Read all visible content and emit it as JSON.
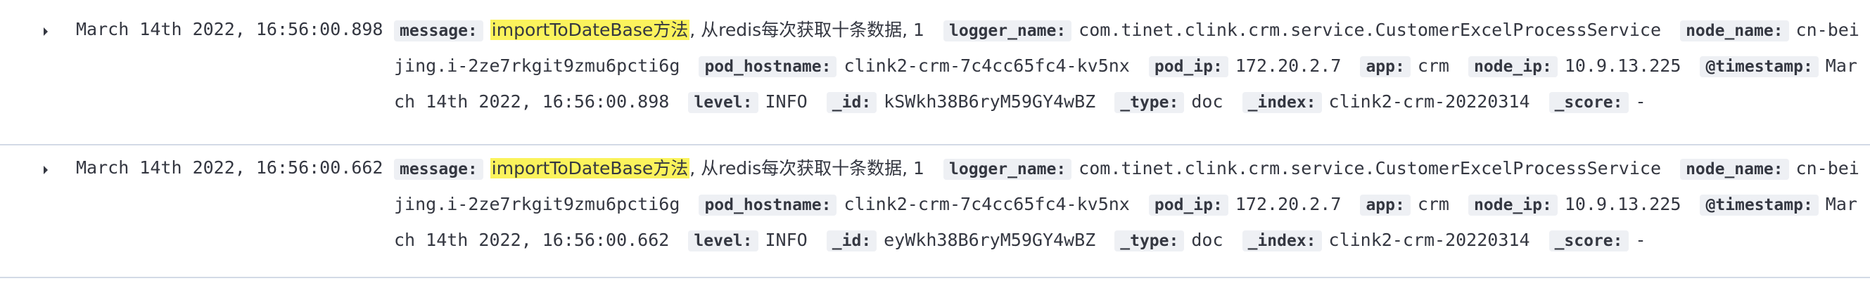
{
  "rows": [
    {
      "time": "March 14th 2022, 16:56:00.898",
      "message_highlight": "importToDateBase方法",
      "message_rest": ", 从redis每次获取十条数据, 1",
      "fields": [
        {
          "key": "logger_name:",
          "value": "com.tinet.clink.crm.service.CustomerExcelProcessService"
        },
        {
          "key": "node_name:",
          "value": "cn-beijing.i-2ze7rkgit9zmu6pcti6g"
        },
        {
          "key": "pod_hostname:",
          "value": "clink2-crm-7c4cc65fc4-kv5nx"
        },
        {
          "key": "pod_ip:",
          "value": "172.20.2.7"
        },
        {
          "key": "app:",
          "value": "crm"
        },
        {
          "key": "node_ip:",
          "value": "10.9.13.225"
        },
        {
          "key": "@timestamp:",
          "value": "March 14th 2022, 16:56:00.898"
        },
        {
          "key": "level:",
          "value": "INFO"
        },
        {
          "key": "_id:",
          "value": "kSWkh38B6ryM59GY4wBZ"
        },
        {
          "key": "_type:",
          "value": "doc"
        },
        {
          "key": "_index:",
          "value": "clink2-crm-20220314"
        },
        {
          "key": "_score:",
          "value": "-"
        }
      ]
    },
    {
      "time": "March 14th 2022, 16:56:00.662",
      "message_highlight": "importToDateBase方法",
      "message_rest": ", 从redis每次获取十条数据, 1",
      "fields": [
        {
          "key": "logger_name:",
          "value": "com.tinet.clink.crm.service.CustomerExcelProcessService"
        },
        {
          "key": "node_name:",
          "value": "cn-beijing.i-2ze7rkgit9zmu6pcti6g"
        },
        {
          "key": "pod_hostname:",
          "value": "clink2-crm-7c4cc65fc4-kv5nx"
        },
        {
          "key": "pod_ip:",
          "value": "172.20.2.7"
        },
        {
          "key": "app:",
          "value": "crm"
        },
        {
          "key": "node_ip:",
          "value": "10.9.13.225"
        },
        {
          "key": "@timestamp:",
          "value": "March 14th 2022, 16:56:00.662"
        },
        {
          "key": "level:",
          "value": "INFO"
        },
        {
          "key": "_id:",
          "value": "eyWkh38B6ryM59GY4wBZ"
        },
        {
          "key": "_type:",
          "value": "doc"
        },
        {
          "key": "_index:",
          "value": "clink2-crm-20220314"
        },
        {
          "key": "_score:",
          "value": "-"
        }
      ]
    }
  ],
  "message_key": "message:",
  "icons": {
    "expand": "chevron-right-icon"
  }
}
